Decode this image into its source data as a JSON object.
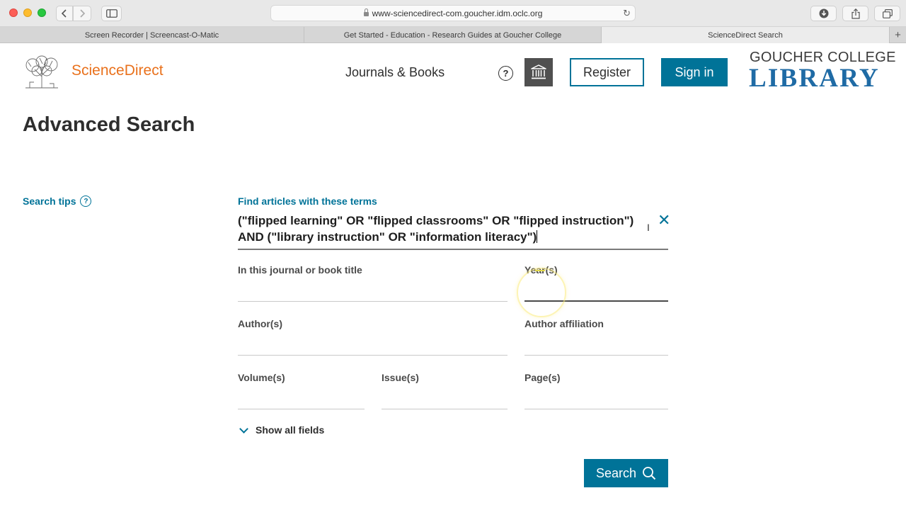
{
  "browser": {
    "url": "www-sciencedirect-com.goucher.idm.oclc.org",
    "tabs": [
      {
        "label": "Screen Recorder | Screencast-O-Matic",
        "active": false
      },
      {
        "label": "Get Started - Education - Research Guides at Goucher College",
        "active": false
      },
      {
        "label": "ScienceDirect Search",
        "active": true
      }
    ]
  },
  "header": {
    "brand": "ScienceDirect",
    "journals_books": "Journals & Books",
    "register": "Register",
    "sign_in": "Sign in",
    "library_top": "GOUCHER COLLEGE",
    "library_bottom": "LIBRARY"
  },
  "page": {
    "title": "Advanced Search",
    "search_tips": "Search tips"
  },
  "form": {
    "terms_label": "Find articles with these terms",
    "terms_value": "(\"flipped learning\" OR \"flipped classrooms\" OR \"flipped instruction\") AND (\"library instruction\" OR \"information literacy\")",
    "journal_label": "In this journal or book title",
    "years_label": "Year(s)",
    "authors_label": "Author(s)",
    "affiliation_label": "Author affiliation",
    "volume_label": "Volume(s)",
    "issue_label": "Issue(s)",
    "pages_label": "Page(s)",
    "show_all": "Show all fields",
    "search_button": "Search"
  },
  "colors": {
    "accent": "#007398",
    "brand_orange": "#e9711c",
    "library_blue": "#1f6ba5"
  }
}
